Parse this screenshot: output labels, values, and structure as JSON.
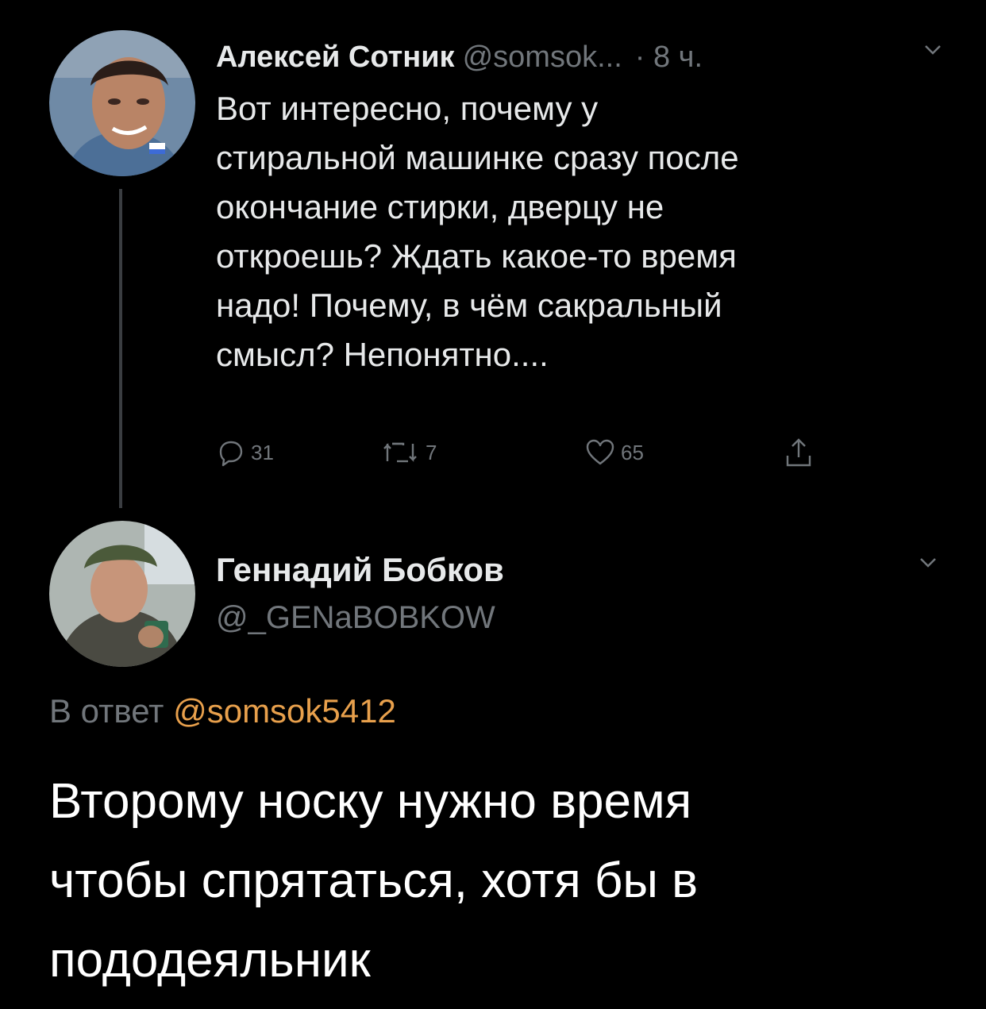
{
  "colors": {
    "background": "#000000",
    "text_primary": "#e7e9ea",
    "text_muted": "#71767b",
    "mention": "#e8a04c",
    "thread_line": "#3a3d41"
  },
  "tweet": {
    "author_name": "Алексей Сотник",
    "author_handle": "@somsok...",
    "time": "· 8 ч.",
    "body_lines": [
      "Вот интересно, почему у",
      "стиральной машинке сразу после",
      "окончание стирки, дверцу не",
      "откроешь? Ждать какое-то время",
      "надо! Почему, в чём сакральный",
      "смысл? Непонятно...."
    ],
    "reply_count": "31",
    "retweet_count": "7",
    "like_count": "65",
    "icons": [
      "reply-icon",
      "retweet-icon",
      "like-icon",
      "share-icon",
      "chevron-down-icon"
    ]
  },
  "reply": {
    "author_name": "Геннадий Бобков",
    "author_handle": "@_GENaBOBKOW",
    "replying_to_prefix": "В ответ",
    "replying_to_handle": "@somsok5412",
    "body_lines": [
      "Второму носку нужно время",
      "чтобы спрятаться, хотя бы в",
      "пододеяльник"
    ]
  }
}
